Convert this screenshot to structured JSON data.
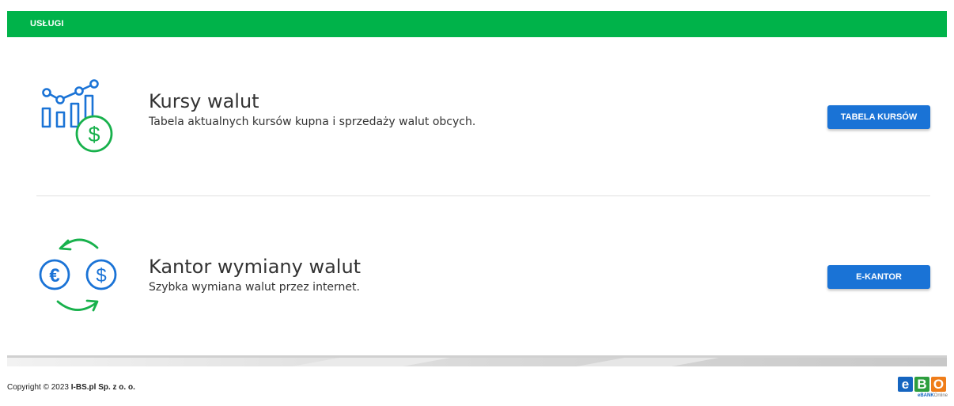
{
  "header": {
    "title": "USŁUGI"
  },
  "services": [
    {
      "title": "Kursy walut",
      "description": "Tabela aktualnych kursów kupna i sprzedaży walut obcych.",
      "button_label": "TABELA KURSÓW",
      "icon": "exchange-rates-chart-dollar-icon"
    },
    {
      "title": "Kantor wymiany walut",
      "description": "Szybka wymiana walut przez internet.",
      "button_label": "E-KANTOR",
      "icon": "currency-exchange-euro-dollar-icon"
    }
  ],
  "footer": {
    "copyright_prefix": "Copyright © 2023 ",
    "company": "I-BS.pl Sp. z o. o.",
    "logo": {
      "letters": [
        "e",
        "B",
        "O"
      ],
      "caption_bold": "eBANK",
      "caption_light": "Online"
    }
  },
  "colors": {
    "header_green": "#00b34a",
    "button_blue": "#1a73d6",
    "icon_blue": "#1a73d6",
    "icon_green": "#18b14c"
  }
}
